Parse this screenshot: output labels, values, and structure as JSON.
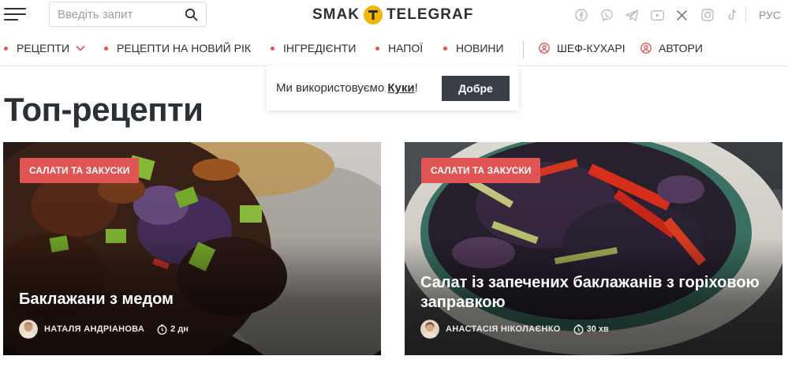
{
  "header": {
    "search_placeholder": "Введіть запит",
    "logo_left": "SMAK",
    "logo_right": "TELEGRAF",
    "socials": [
      "facebook-icon",
      "viber-icon",
      "telegram-icon",
      "youtube-icon",
      "x-icon",
      "instagram-icon",
      "tiktok-icon"
    ],
    "lang": "РУС"
  },
  "nav": {
    "items": [
      {
        "label": "РЕЦЕПТИ",
        "dot": true,
        "dropdown": true
      },
      {
        "label": "РЕЦЕПТИ НА НОВИЙ РІК",
        "dot": true
      },
      {
        "label": "ІНГРЕДІЄНТИ",
        "dot": true
      },
      {
        "label": "НАПОЇ",
        "dot": true
      },
      {
        "label": "НОВИНИ",
        "dot": true
      },
      {
        "label": "ШЕФ-КУХАРІ",
        "icon": "person-icon"
      },
      {
        "label": "АВТОРИ",
        "icon": "person-icon"
      }
    ]
  },
  "cookie": {
    "text": "Ми використовуємо ",
    "link": "Куки",
    "suffix": "!",
    "button": "Добре"
  },
  "page_title": "Топ-рецепти",
  "cards": [
    {
      "category": "САЛАТИ ТА ЗАКУСКИ",
      "title": "Баклажани з медом",
      "author": "НАТАЛЯ АНДРІАНОВА",
      "time": "2 дн"
    },
    {
      "category": "САЛАТИ ТА ЗАКУСКИ",
      "title": "Салат із запечених баклажанів з горіховою заправкою",
      "author": "АНАСТАСІЯ НІКОЛАЄНКО",
      "time": "30 хв"
    }
  ],
  "colors": {
    "accent": "#e05454",
    "text": "#2b2f36",
    "logo_yellow": "#f2b705",
    "social_gray": "#b7bcc4"
  }
}
